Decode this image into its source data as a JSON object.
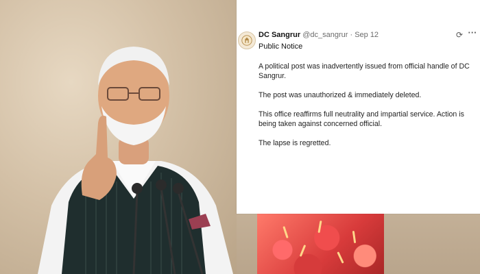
{
  "tweet": {
    "name": "DC Sangrur",
    "handle": "@dc_sangrur",
    "separator": "·",
    "date": "Sep 12",
    "subtitle": "Public Notice",
    "paragraphs": [
      "A political post was inadvertently issued from official handle of DC Sangrur.",
      "The post was unauthorized & immediately deleted.",
      "This office reaffirms full neutrality and impartial service. Action is being taken against concerned official.",
      "The lapse is regretted."
    ]
  },
  "icons": {
    "avatar": "government-emblem-icon",
    "grok": "grok-icon",
    "more": "more-icon",
    "grok_glyph": "⟳",
    "more_glyph": "···"
  },
  "colors": {
    "card_bg": "#ffffff",
    "text": "#111111",
    "muted": "#6b6b6b"
  }
}
